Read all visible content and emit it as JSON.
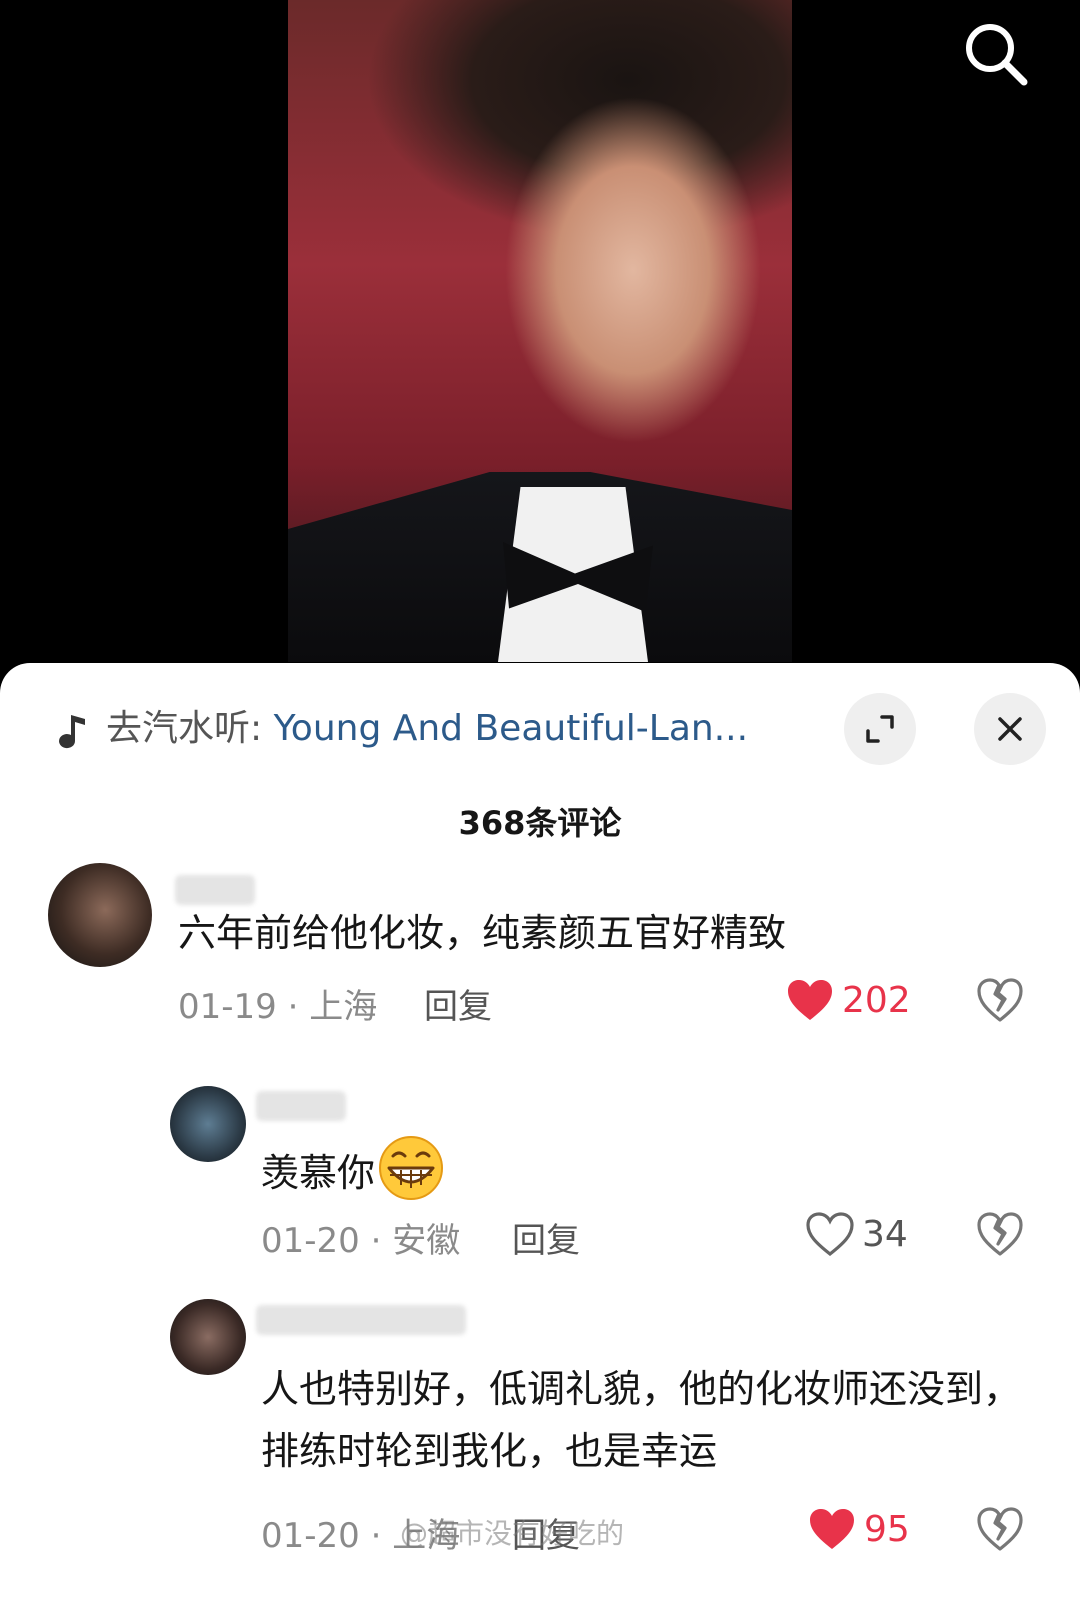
{
  "music": {
    "prefix": "去汽水听: ",
    "song": "Young And Beautiful-Lan..."
  },
  "comments_header": {
    "count_label": "368条评论"
  },
  "comments": [
    {
      "text": "六年前给他化妆，纯素颜五官好精致",
      "date_location": "01-19 · 上海",
      "reply_label": "回复",
      "likes": "202",
      "liked": true
    },
    {
      "text": "羡慕你",
      "emoji": "grinning-face",
      "date_location": "01-20 · 安徽",
      "reply_label": "回复",
      "likes": "34",
      "liked": false
    },
    {
      "text": "人也特别好，低调礼貌，他的化妆师还没到，排练时轮到我化，也是幸运",
      "date_location": "01-20 · 上海",
      "reply_label": "回复",
      "likes": "95",
      "liked": true
    }
  ],
  "watermark": "@超市没有好吃的",
  "colors": {
    "like_red": "#e8334a",
    "song_link": "#2c5a8a"
  },
  "icons": [
    "search-icon",
    "music-note-icon",
    "expand-icon",
    "close-icon",
    "heart-icon",
    "broken-heart-icon"
  ]
}
